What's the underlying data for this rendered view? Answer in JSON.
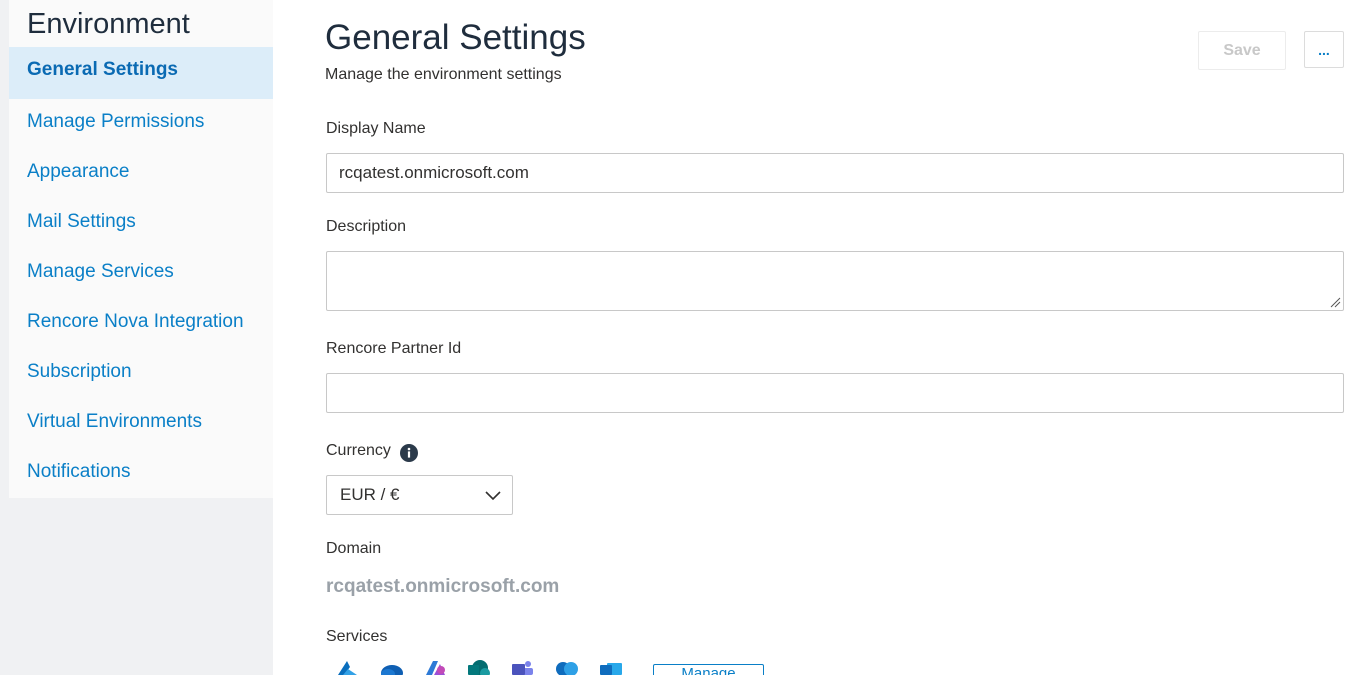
{
  "sidebar": {
    "title": "Environment",
    "items": [
      {
        "label": "General Settings",
        "active": true
      },
      {
        "label": "Manage Permissions"
      },
      {
        "label": "Appearance"
      },
      {
        "label": "Mail Settings"
      },
      {
        "label": "Manage Services"
      },
      {
        "label": "Rencore Nova Integration"
      },
      {
        "label": "Subscription"
      },
      {
        "label": "Virtual Environments"
      },
      {
        "label": "Notifications"
      }
    ]
  },
  "header": {
    "title": "General Settings",
    "subtitle": "Manage the environment settings",
    "save_label": "Save",
    "more_label": "..."
  },
  "form": {
    "display_name": {
      "label": "Display Name",
      "value": "rcqatest.onmicrosoft.com"
    },
    "description": {
      "label": "Description",
      "value": ""
    },
    "partner_id": {
      "label": "Rencore Partner Id",
      "value": ""
    },
    "currency": {
      "label": "Currency",
      "value": "EUR / €",
      "info_icon": "info-icon"
    },
    "domain": {
      "label": "Domain",
      "value": "rcqatest.onmicrosoft.com"
    },
    "services": {
      "label": "Services",
      "icons": [
        "azure-icon",
        "onedrive-icon",
        "power-platform-icon",
        "sharepoint-icon",
        "teams-icon",
        "copilot-icon",
        "outlook-icon"
      ],
      "manage_label": "Manage"
    }
  },
  "colors": {
    "accent": "#0a7fc7",
    "sidebar_active_bg": "#dcedf9",
    "sidebar_bg": "#fafafa",
    "page_bg_left": "#f0f1f3",
    "muted_text": "#9aa1a8"
  }
}
